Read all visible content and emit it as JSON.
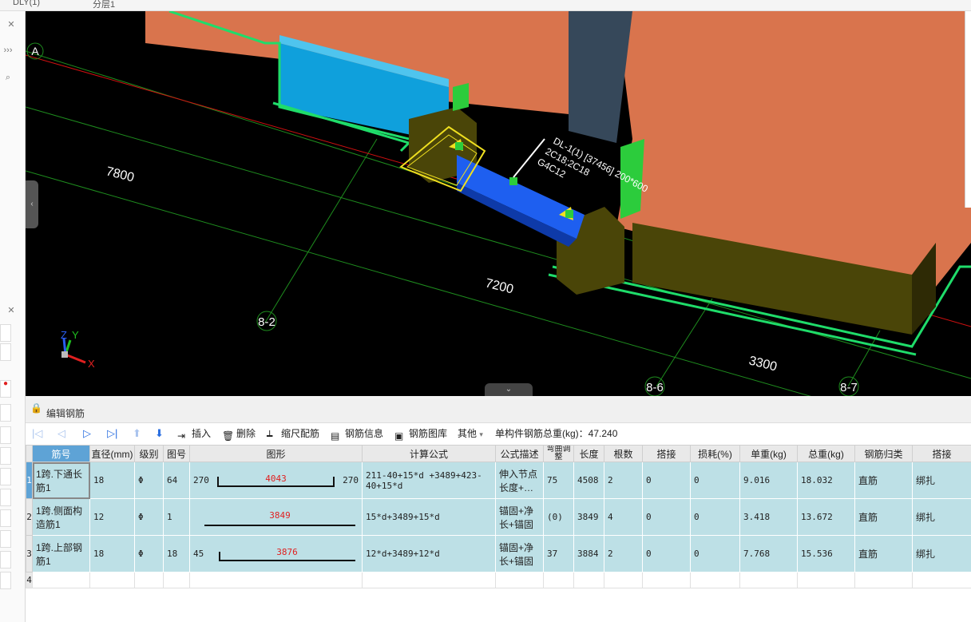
{
  "top_strip": {
    "left_text": "DLY(1)",
    "mid_text": "分层1"
  },
  "viewport": {
    "axis_labels": [
      "A",
      "8-2",
      "8-6",
      "8-7"
    ],
    "dimensions": [
      "7800",
      "7200",
      "3300"
    ],
    "beam_annotation": [
      "DL-1(1) [37456] 200*600",
      "2C18;2C18",
      "G4C12"
    ],
    "gizmo": {
      "x": "X",
      "y": "Y",
      "z": "Z"
    },
    "colors": {
      "slab": "#d9744d",
      "beam": "#1e5ff0",
      "column": "#4a4508",
      "outline": "#1fdc6a",
      "grid": "#1e8c1e",
      "axis_red": "#d01010",
      "blue_wall": "#0fa0dc",
      "slate": "#36485a"
    }
  },
  "editor": {
    "title": "编辑钢筋",
    "toolbar": {
      "insert": "插入",
      "delete": "删除",
      "scale_rebar": "缩尺配筋",
      "rebar_info": "钢筋信息",
      "rebar_lib": "钢筋图库",
      "other": "其他",
      "total_weight": "单构件钢筋总重(kg)：47.240"
    },
    "columns": [
      "筋号",
      "直径(mm)",
      "级别",
      "图号",
      "图形",
      "计算公式",
      "公式描述",
      "弯曲调整",
      "长度",
      "根数",
      "搭接",
      "损耗(%)",
      "单重(kg)",
      "总重(kg)",
      "钢筋归类",
      "搭接"
    ],
    "rows": [
      {
        "index": "1",
        "name": "1跨.下通长筋1",
        "diameter": "18",
        "grade": "Φ",
        "fig_no": "64",
        "shape_left": "270",
        "shape_mid": "4043",
        "shape_right": "270",
        "formula": "211-40+15*d +3489+423-40+15*d",
        "desc": "伸入节点长度+…",
        "bend": "75",
        "length": "4508",
        "count": "2",
        "lap": "0",
        "loss": "0",
        "unit_wt": "9.016",
        "total_wt": "18.032",
        "category": "直筋",
        "lap_type": "绑扎"
      },
      {
        "index": "2",
        "name": "1跨.侧面构造筋1",
        "diameter": "12",
        "grade": "Φ",
        "fig_no": "1",
        "shape_left": "",
        "shape_mid": "3849",
        "shape_right": "",
        "formula": "15*d+3489+15*d",
        "desc": "锚固+净长+锚固",
        "bend": "(0)",
        "length": "3849",
        "count": "4",
        "lap": "0",
        "loss": "0",
        "unit_wt": "3.418",
        "total_wt": "13.672",
        "category": "直筋",
        "lap_type": "绑扎"
      },
      {
        "index": "3",
        "name": "1跨.上部钢筋1",
        "diameter": "18",
        "grade": "Φ",
        "fig_no": "18",
        "shape_left": "45",
        "shape_mid": "3876",
        "shape_right": "",
        "formula": "12*d+3489+12*d",
        "desc": "锚固+净长+锚固",
        "bend": "37",
        "length": "3884",
        "count": "2",
        "lap": "0",
        "loss": "0",
        "unit_wt": "7.768",
        "total_wt": "15.536",
        "category": "直筋",
        "lap_type": "绑扎"
      }
    ],
    "empty_row_index": "4"
  }
}
